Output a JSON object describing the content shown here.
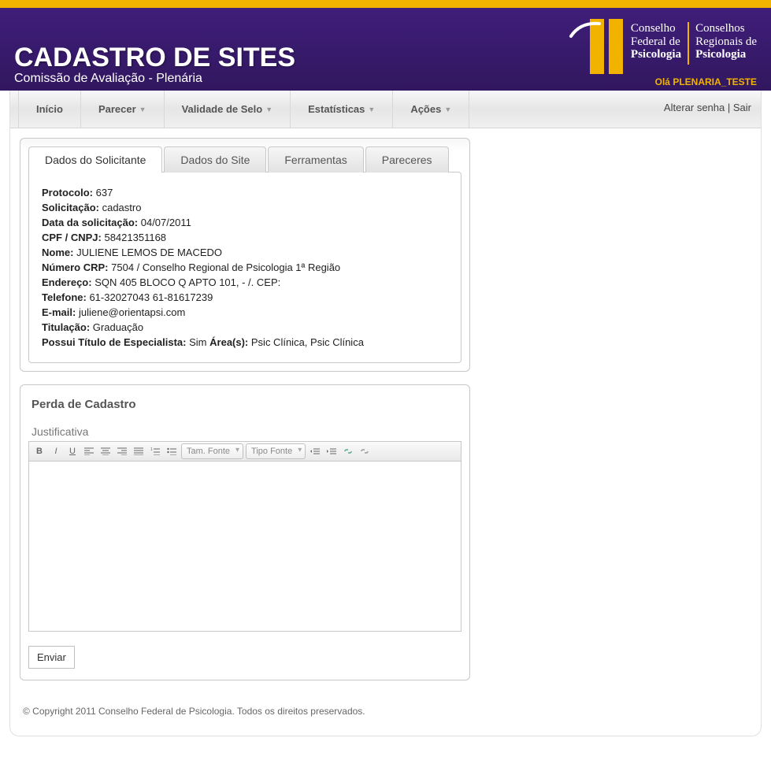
{
  "header": {
    "title": "CADASTRO DE SITES",
    "subtitle": "Comissão de Avaliação - Plenária",
    "greeting": "Olá PLENARIA_TESTE",
    "logo_left_l1": "Conselho",
    "logo_left_l2": "Federal de",
    "logo_left_l3": "Psicologia",
    "logo_right_l1": "Conselhos",
    "logo_right_l2": "Regionais de",
    "logo_right_l3": "Psicologia"
  },
  "nav": {
    "items": [
      {
        "label": "Início",
        "has_dropdown": false
      },
      {
        "label": "Parecer",
        "has_dropdown": true
      },
      {
        "label": "Validade de Selo",
        "has_dropdown": true
      },
      {
        "label": "Estatísticas",
        "has_dropdown": true
      },
      {
        "label": "Ações",
        "has_dropdown": true
      }
    ],
    "alterar_senha": "Alterar senha",
    "sair": "Sair"
  },
  "tabs": [
    {
      "label": "Dados do Solicitante",
      "active": true
    },
    {
      "label": "Dados do Site",
      "active": false
    },
    {
      "label": "Ferramentas",
      "active": false
    },
    {
      "label": "Pareceres",
      "active": false
    }
  ],
  "solicitante": {
    "protocolo_label": "Protocolo:",
    "protocolo_value": "637",
    "solicitacao_label": "Solicitação:",
    "solicitacao_value": "cadastro",
    "data_label": "Data da solicitação:",
    "data_value": "04/07/2011",
    "cpf_label": "CPF / CNPJ:",
    "cpf_value": "58421351168",
    "nome_label": "Nome:",
    "nome_value": "JULIENE LEMOS DE MACEDO",
    "crp_label": "Número CRP:",
    "crp_value": "7504 / Conselho Regional de Psicologia 1ª Região",
    "endereco_label": "Endereço:",
    "endereco_value": "SQN 405 BLOCO Q APTO 101, - /. CEP:",
    "telefone_label": "Telefone:",
    "telefone_value": "61-32027043 61-81617239",
    "email_label": "E-mail:",
    "email_value": "juliene@orientapsi.com",
    "titulacao_label": "Titulação:",
    "titulacao_value": "Graduação",
    "especialista_label": "Possui Título de Especialista:",
    "especialista_value": "Sim",
    "areas_label": "Área(s):",
    "areas_value": "Psic Clínica, Psic Clínica"
  },
  "panel": {
    "title": "Perda de Cadastro",
    "editor_label": "Justificativa",
    "font_size_placeholder": "Tam. Fonte",
    "font_family_placeholder": "Tipo Fonte",
    "submit_label": "Enviar"
  },
  "footer": "© Copyright 2011 Conselho Federal de Psicologia. Todos os direitos preservados."
}
